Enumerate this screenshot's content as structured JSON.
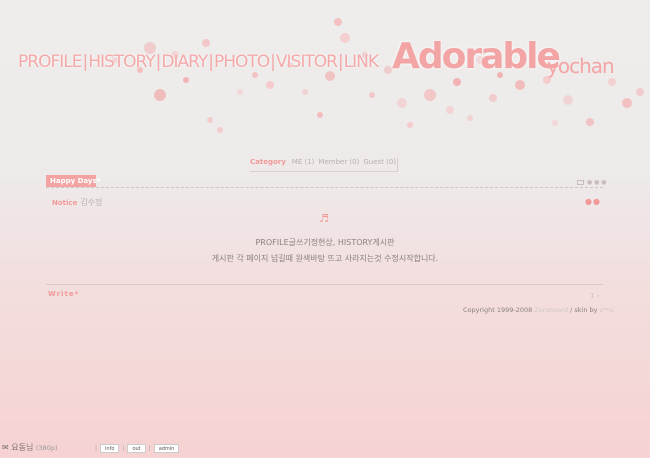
{
  "header": {
    "nav_items": [
      "PROFILE",
      "HISTORY",
      "DIARY",
      "PHOTO",
      "VISITOR",
      "LINK"
    ],
    "separator": "|",
    "brand": "Adorable",
    "brand_sub": "yochan"
  },
  "board": {
    "category_label": "Category",
    "categories": [
      "ME (1)",
      "Member (0)",
      "Guest (0)"
    ],
    "title": "Happy Days*",
    "notice_label": "Notice",
    "notice_author": "김수정",
    "message_line1": "PROFILE글쓰기정현상, HISTORY게시판",
    "message_line2": "게시판 각 페이지 넘길때 원색바탕 뜨고 사라지는것 수정시작합니다.",
    "write_label": "Write*",
    "copyright_prefix": "Copyright 1999-2008",
    "copyright_brand": "Zeroboard",
    "copyright_skin": "/ skin by",
    "copyright_author": "z**u"
  },
  "footer": {
    "user_name": "요동님",
    "user_points": "(380p)",
    "buttons": [
      "info",
      "out",
      "admin"
    ]
  },
  "colors": {
    "accent": "#f4a3a3",
    "text": "#8a8080"
  }
}
